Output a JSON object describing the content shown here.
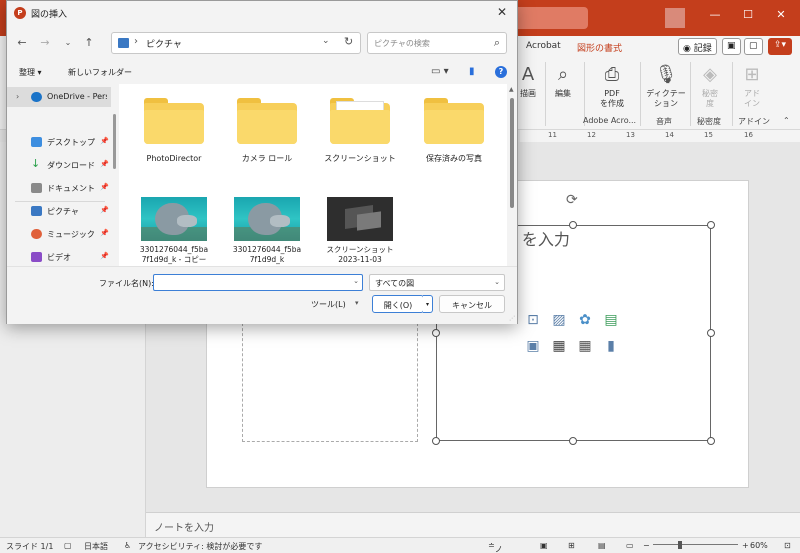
{
  "powerpoint": {
    "tabs": [
      "Acrobat",
      "図形の書式"
    ],
    "record_label": "記録",
    "ribbon": {
      "items": [
        {
          "label": "描画",
          "icon": "draw-icon"
        },
        {
          "label": "編集",
          "icon": "search-icon"
        },
        {
          "label": "PDF\nを作成",
          "icon": "pdf-icon"
        },
        {
          "label": "ディクテー\nション",
          "icon": "microphone-icon"
        },
        {
          "label": "秘密\n度",
          "icon": "sensitivity-icon"
        },
        {
          "label": "アド\nイン",
          "icon": "addins-icon"
        }
      ],
      "groups": [
        "Adobe Acro...",
        "音声",
        "秘密度",
        "アドイン"
      ]
    },
    "ruler_marks": [
      "11",
      "12",
      "13",
      "14",
      "15",
      "16"
    ],
    "placeholder_text": "- を入力",
    "notes_placeholder": "ノートを入力",
    "status": {
      "slide": "スライド 1/1",
      "language": "日本語",
      "accessibility": "アクセシビリティ: 検討が必要です",
      "notes": "ノート",
      "zoom": "60%"
    }
  },
  "dialog": {
    "title": "図の挿入",
    "address": {
      "crumb": "ピクチャ"
    },
    "search_placeholder": "ピクチャの検索",
    "toolbar": {
      "organize": "整理 ▾",
      "new_folder": "新しいフォルダー"
    },
    "nav_items": [
      {
        "label": "OneDrive - Perso",
        "icon_color": "#1a73c8",
        "selected": true,
        "chevron": true,
        "pin": false
      },
      {
        "label": "デスクトップ",
        "icon_color": "#3d8ee0",
        "selected": false,
        "chevron": false,
        "pin": true
      },
      {
        "label": "ダウンロード",
        "icon_color": "#2aa04a",
        "selected": false,
        "chevron": false,
        "pin": true
      },
      {
        "label": "ドキュメント",
        "icon_color": "#7a7a7a",
        "selected": false,
        "chevron": false,
        "pin": true
      },
      {
        "label": "ピクチャ",
        "icon_color": "#3a78c3",
        "selected": false,
        "chevron": false,
        "pin": true
      },
      {
        "label": "ミュージック",
        "icon_color": "#e0603a",
        "selected": false,
        "chevron": false,
        "pin": true
      },
      {
        "label": "ビデオ",
        "icon_color": "#8a4cc7",
        "selected": false,
        "chevron": false,
        "pin": true
      }
    ],
    "files": [
      {
        "name": "PhotoDirector",
        "kind": "folder"
      },
      {
        "name": "カメラ ロール",
        "kind": "folder"
      },
      {
        "name": "スクリーンショット",
        "kind": "folder-paper"
      },
      {
        "name": "保存済みの写真",
        "kind": "folder"
      },
      {
        "name": "3301276044_f5ba\n7f1d9d_k - コピー",
        "kind": "dolphin"
      },
      {
        "name": "3301276044_f5ba\n7f1d9d_k",
        "kind": "dolphin"
      },
      {
        "name": "スクリーンショット\n2023-11-03",
        "kind": "screen"
      }
    ],
    "filename_label": "ファイル名(N):",
    "filename_value": "",
    "type_filter": "すべての図",
    "tools_label": "ツール(L)",
    "open_label": "開く(O)",
    "cancel_label": "キャンセル"
  }
}
